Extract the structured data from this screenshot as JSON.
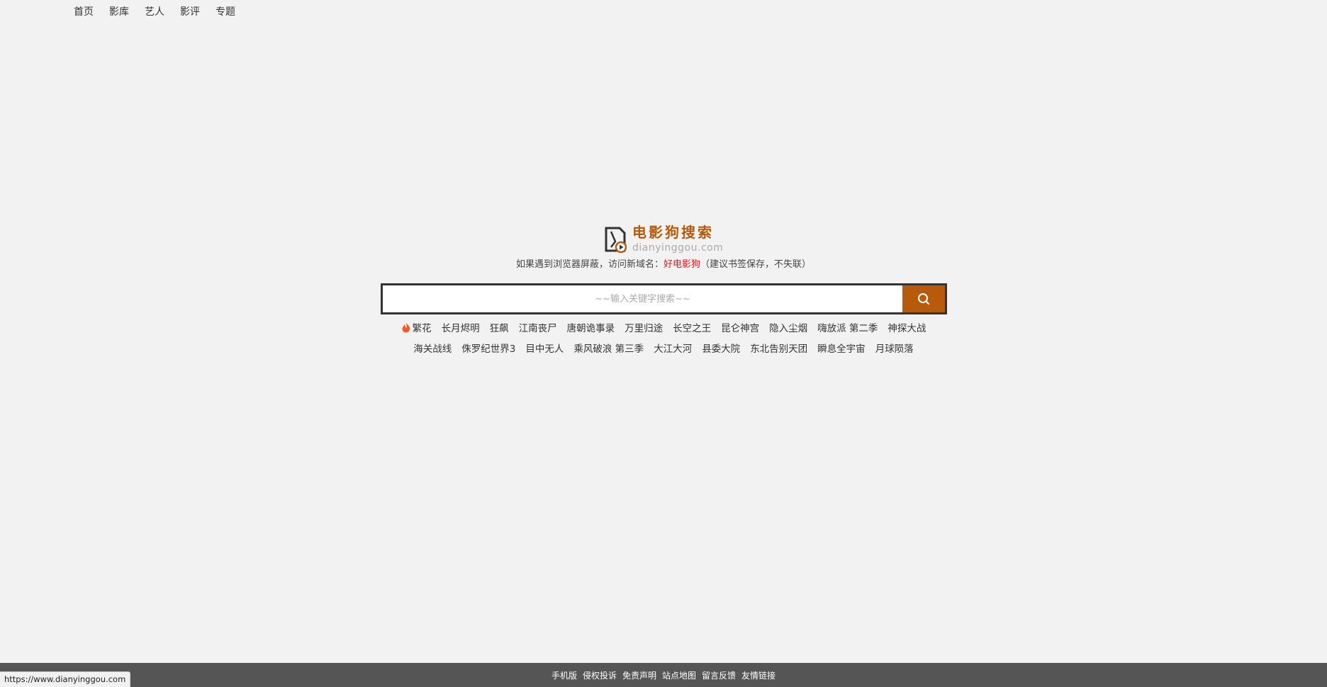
{
  "nav": {
    "items": [
      "首页",
      "影库",
      "艺人",
      "影评",
      "专题"
    ]
  },
  "logo": {
    "title": "电影狗搜索",
    "domain": "dianyinggou.com",
    "brand_color": "#b85a0c"
  },
  "notice": {
    "prefix": "如果遇到浏览器屏蔽，访问新域名：",
    "highlight": "好电影狗",
    "suffix": "（建议书签保存，不失联）",
    "highlight_color": "#e0141a"
  },
  "search": {
    "placeholder": "~~输入关键字搜索~~",
    "value": "",
    "button_icon": "search-icon"
  },
  "hot": {
    "icon": "fire-icon",
    "row1": [
      "繁花",
      "长月烬明",
      "狂飙",
      "江南丧尸",
      "唐朝诡事录",
      "万里归途",
      "长空之王",
      "昆仑神宫",
      "隐入尘烟",
      "嗨放派 第二季",
      "神探大战"
    ],
    "row2": [
      "海关战线",
      "侏罗纪世界3",
      "目中无人",
      "乘风破浪 第三季",
      "大江大河",
      "县委大院",
      "东北告别天团",
      "瞬息全宇宙",
      "月球陨落"
    ]
  },
  "footer": {
    "links": [
      "手机版",
      "侵权投诉",
      "免责声明",
      "站点地图",
      "留言反馈",
      "友情链接"
    ]
  },
  "status_bar": {
    "url": "https://www.dianyinggou.com"
  }
}
